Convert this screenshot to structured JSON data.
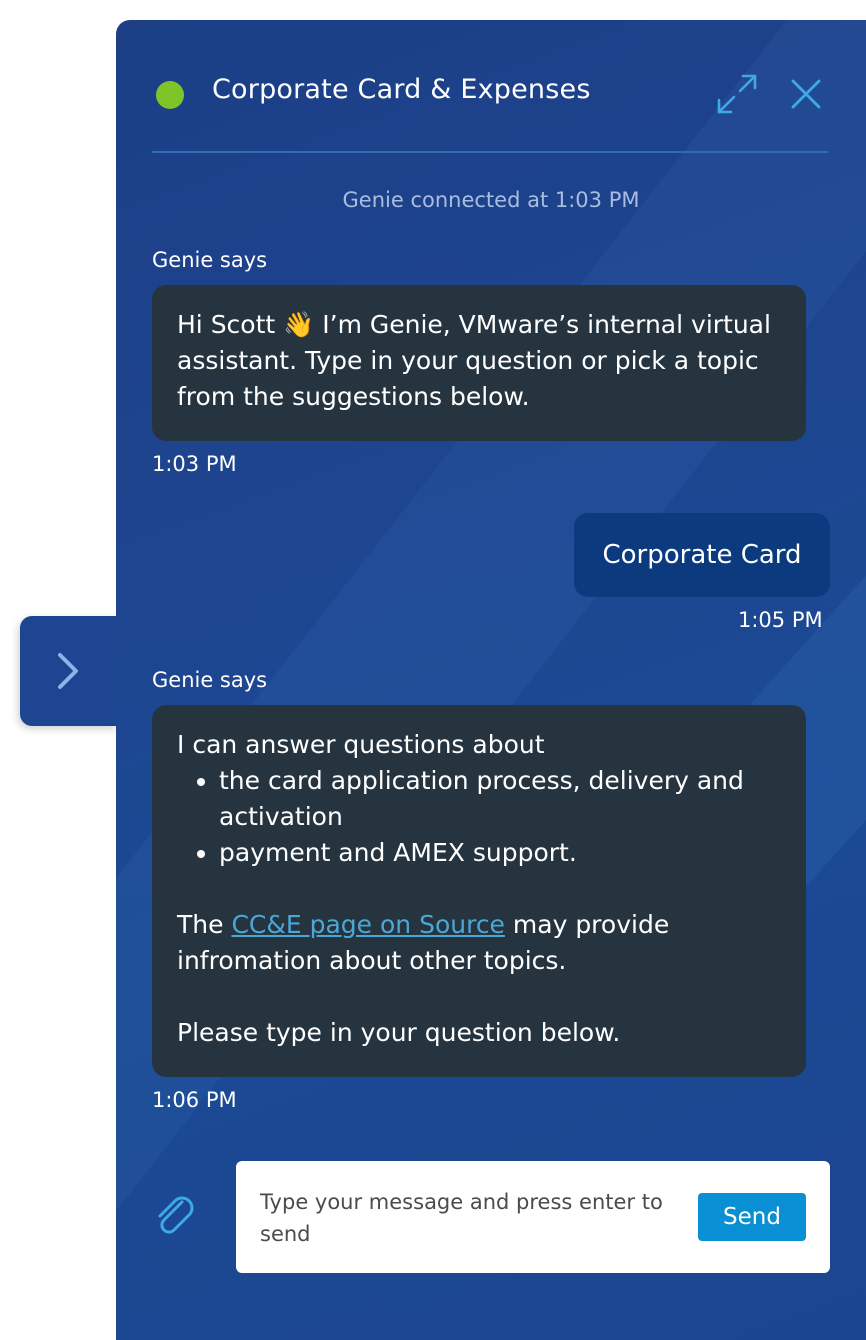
{
  "header": {
    "title": "Corporate Card & Expenses",
    "status_color": "#7ec529",
    "expand_icon": "expand-arrows-icon",
    "close_icon": "close-icon"
  },
  "conversation": {
    "connected_text": "Genie connected at 1:03 PM",
    "messages": [
      {
        "sender_label": "Genie says",
        "greeting_prefix": "Hi Scott ",
        "emoji": "👋",
        "greeting_rest": " I’m Genie, VMware’s internal virtual assistant. Type in your question or pick a topic from the suggestions below.",
        "time": "1:03 PM"
      },
      {
        "user_text": "Corporate Card",
        "time": "1:05 PM"
      },
      {
        "sender_label": "Genie says",
        "intro": "I can answer questions about",
        "bullets": [
          "the card application process, delivery and activation",
          "payment and AMEX support."
        ],
        "para_prefix": "The ",
        "link_text": "CC&E page on Source",
        "para_suffix": " may provide infromation about other topics.",
        "closing": "Please type in your question below.",
        "time": "1:06 PM"
      }
    ]
  },
  "composer": {
    "placeholder": "Type your message and press enter to send",
    "send_label": "Send",
    "attach_icon": "paperclip-icon"
  },
  "side_tab": {
    "icon": "chevron-right-icon"
  },
  "colors": {
    "panel_bg": "#1e4590",
    "bot_bubble": "#263440",
    "user_bubble": "#0b3a7e",
    "send_button": "#0b8fd4",
    "link": "#4aa8d6",
    "icon_accent": "#3fa9e8"
  }
}
